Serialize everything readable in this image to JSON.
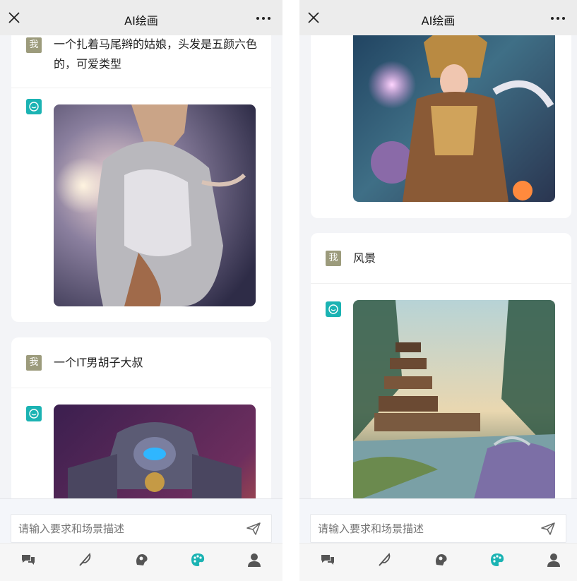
{
  "header": {
    "title": "AI绘画"
  },
  "colors": {
    "accent": "#1bb3b3",
    "user_avatar": "#9c9b7c"
  },
  "left": {
    "messages": [
      {
        "user_avatar": "我",
        "text": "一个扎着马尾辫的姑娘，头发是五颜六色的，可爱类型"
      },
      {
        "user_avatar": "我",
        "text": "一个IT男胡子大叔"
      }
    ]
  },
  "right": {
    "messages": [
      {
        "user_avatar": "我",
        "text": "风景"
      }
    ]
  },
  "input": {
    "placeholder": "请输入要求和场景描述"
  },
  "icons": {
    "header": [
      "close-icon",
      "more-icon"
    ],
    "input": [
      "send-icon"
    ],
    "tabs": [
      "chat-icon",
      "feather-icon",
      "brain-icon",
      "palette-icon",
      "user-icon"
    ]
  }
}
